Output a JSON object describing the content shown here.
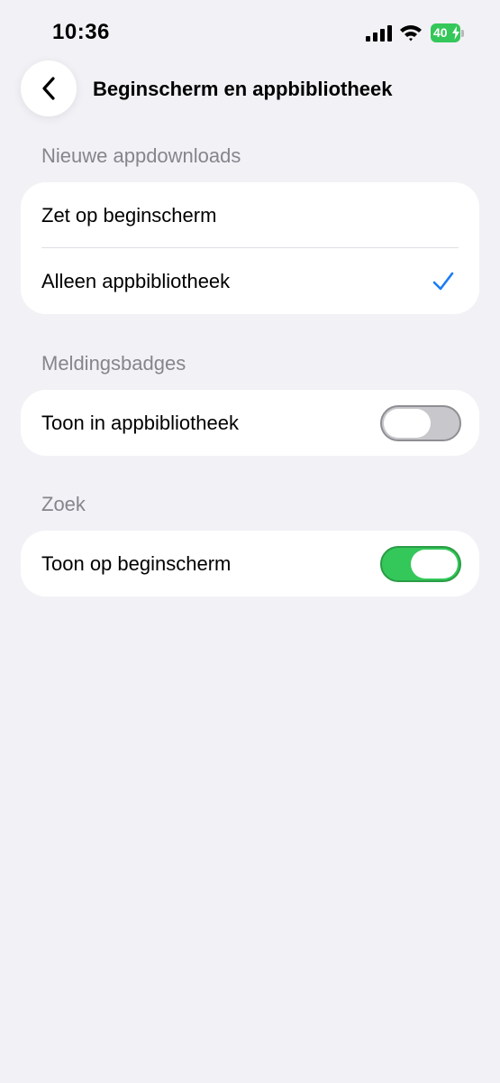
{
  "status_bar": {
    "time": "10:36",
    "battery": "40"
  },
  "nav": {
    "title": "Beginscherm en appbibliotheek"
  },
  "sections": {
    "new_downloads": {
      "header": "Nieuwe appdownloads",
      "options": [
        {
          "label": "Zet op beginscherm",
          "selected": false
        },
        {
          "label": "Alleen appbibliotheek",
          "selected": true
        }
      ]
    },
    "badges": {
      "header": "Meldingsbadges",
      "row_label": "Toon in appbibliotheek",
      "enabled": false
    },
    "search": {
      "header": "Zoek",
      "row_label": "Toon op beginscherm",
      "enabled": true
    }
  },
  "colors": {
    "accent": "#1a7cf5",
    "toggle_on": "#34c759",
    "background": "#f2f1f6"
  },
  "icons": [
    "cellular-signal-icon",
    "wifi-icon",
    "battery-icon",
    "chevron-left-icon",
    "checkmark-icon"
  ]
}
